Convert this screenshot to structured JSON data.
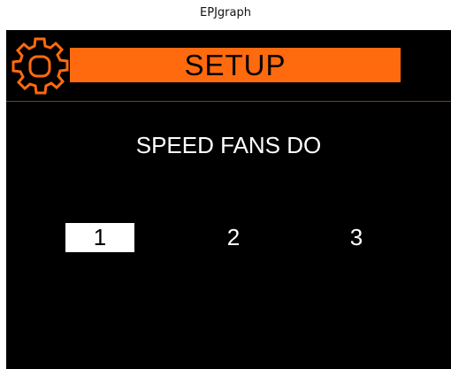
{
  "window": {
    "title": "EPJgraph"
  },
  "header": {
    "title": "SETUP",
    "icon": "gear-icon",
    "accent_color": "#ff6a0e"
  },
  "main": {
    "prompt": "SPEED FANS DO",
    "options": [
      {
        "label": "1",
        "selected": true
      },
      {
        "label": "2",
        "selected": false
      },
      {
        "label": "3",
        "selected": false
      }
    ]
  }
}
